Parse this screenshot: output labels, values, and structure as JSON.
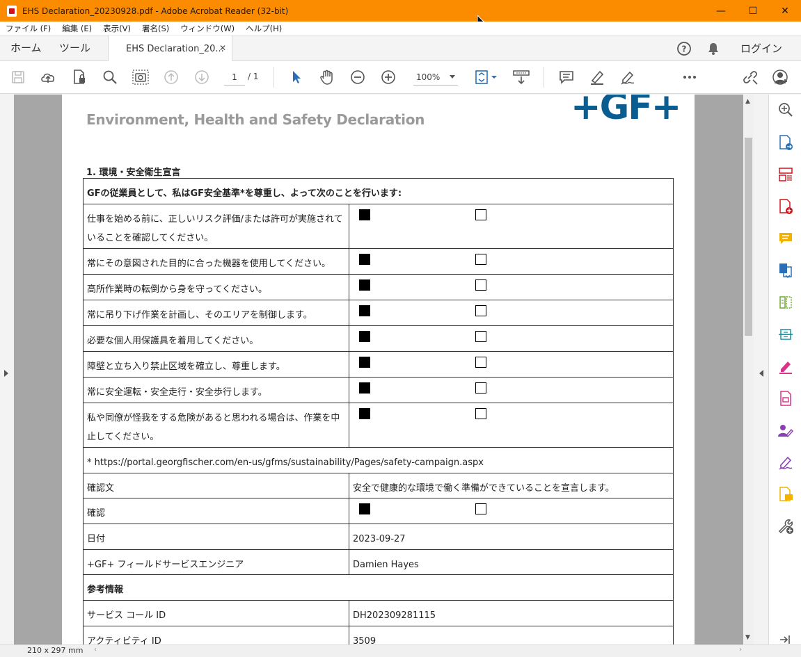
{
  "window": {
    "title": "EHS Declaration_20230928.pdf - Adobe Acrobat Reader (32-bit)",
    "minimize": "—",
    "maximize": "☐",
    "close": "✕"
  },
  "menu": [
    "ファイル (F)",
    "編集 (E)",
    "表示(V)",
    "署名(S)",
    "ウィンドウ(W)",
    "ヘルプ(H)"
  ],
  "tabs": {
    "home": "ホーム",
    "tools": "ツール",
    "document": "EHS Declaration_20...",
    "document_close": "✕",
    "login": "ログイン"
  },
  "toolbar": {
    "page_current": "1",
    "page_total": "/ 1",
    "zoom": "100%"
  },
  "document": {
    "title": "Environment, Health and Safety Declaration",
    "logo": "+GF+",
    "section_heading": "1. 環境・安全衛生宣言",
    "table_header": "GFの従業員として、私はGF安全基準*を尊重し、よって次のことを行います:",
    "checklist": [
      {
        "text": "仕事を始める前に、正しいリスク評価/または許可が実施されていることを確認してください。",
        "checked": true
      },
      {
        "text": "常にその意図された目的に合った機器を使用してください。",
        "checked": true
      },
      {
        "text": "高所作業時の転倒から身を守ってください。",
        "checked": true
      },
      {
        "text": "常に吊り下げ作業を計画し、そのエリアを制御します。",
        "checked": true
      },
      {
        "text": "必要な個人用保護具を着用してください。",
        "checked": true
      },
      {
        "text": "障壁と立ち入り禁止区域を確立し、尊重します。",
        "checked": true
      },
      {
        "text": "常に安全運転・安全走行・安全歩行します。",
        "checked": true
      },
      {
        "text": "私や同僚が怪我をする危険があると思われる場合は、作業を中止してください。",
        "checked": true
      }
    ],
    "footnote": "* https://portal.georgfischer.com/en-us/gfms/sustainability/Pages/safety-campaign.aspx",
    "confirm_text_label": "確認文",
    "confirm_text_value": "安全で健康的な環境で働く準備ができていることを宣言します。",
    "confirm_label": "確認",
    "date_label": "日付",
    "date_value": "2023-09-27",
    "engineer_label": "+GF+ フィールドサービスエンジニア",
    "engineer_value": "Damien Hayes",
    "reference_heading": "参考情報",
    "service_call_label": "サービス コール ID",
    "service_call_value": "DH202309281115",
    "activity_label": "アクティビティ ID",
    "activity_value": "3509"
  },
  "status": {
    "page_size": "210 x 297 mm"
  },
  "colors": {
    "titlebar": "#fb8c00",
    "logo": "#0a5d91",
    "accent_blue": "#2a6fb6",
    "tools_accent": "#d0141c"
  }
}
